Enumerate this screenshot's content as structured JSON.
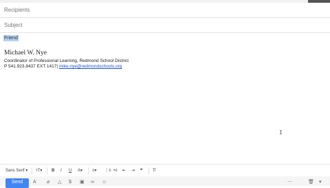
{
  "header": {
    "recipients_placeholder": "Recipients",
    "subject_placeholder": "Subject"
  },
  "body": {
    "selected_word": "Friend",
    "signature": {
      "name": "Michael W. Nye",
      "title": "Coordinator of Professional Learning, Redmond School District",
      "phone": "P 541.923.8437 EXT 1417|",
      "email": "mike.nye@redmondschools.org"
    }
  },
  "formatting_toolbar": {
    "font_label": "Sans Serif",
    "size_icon": "text-size-icon",
    "bold_label": "B",
    "italic_label": "I",
    "underline_label": "U",
    "text_color_label": "A",
    "align_icon": "align-icon",
    "numbered_list_icon": "numbered-list-icon",
    "bulleted_list_icon": "bulleted-list-icon",
    "indent_less_icon": "indent-less-icon",
    "indent_more_icon": "indent-more-icon",
    "quote_icon": "quote-icon",
    "remove_formatting_icon": "remove-formatting-icon"
  },
  "bottom_toolbar": {
    "send_label": "Send"
  }
}
